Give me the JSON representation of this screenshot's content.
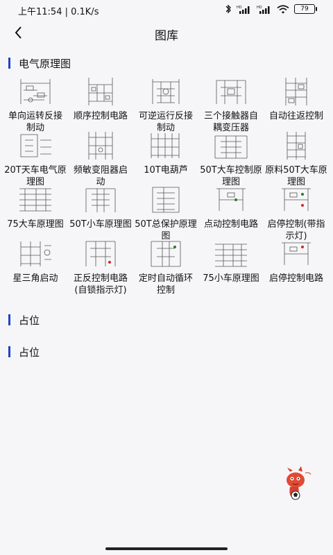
{
  "status": {
    "time_speed": "上午11:54 | 0.1K/s",
    "battery": "79",
    "icons": [
      "bluetooth-icon",
      "hd-signal-icon",
      "hd-signal-icon",
      "wifi-icon",
      "battery-icon"
    ]
  },
  "header": {
    "title": "图库",
    "back_icon": "chevron-left-icon"
  },
  "sections": [
    {
      "title": "电气原理图"
    },
    {
      "title": "占位"
    },
    {
      "title": "占位"
    }
  ],
  "items": [
    {
      "label": "单向运转反接制动"
    },
    {
      "label": "顺序控制电路"
    },
    {
      "label": "可逆运行反接制动"
    },
    {
      "label": "三个接触器自耦变压器"
    },
    {
      "label": "自动往返控制"
    },
    {
      "label": "20T天车电气原理图"
    },
    {
      "label": "频敏变阻器启动"
    },
    {
      "label": "10T电葫芦"
    },
    {
      "label": "50T大车控制原理图"
    },
    {
      "label": "原料50T大车原理图"
    },
    {
      "label": "75大车原理图"
    },
    {
      "label": "50T小车原理图"
    },
    {
      "label": "50T总保护原理图"
    },
    {
      "label": "点动控制电路"
    },
    {
      "label": "启停控制(带指示灯)"
    },
    {
      "label": "星三角启动"
    },
    {
      "label": "正反控制电路(自锁指示灯)"
    },
    {
      "label": "定时自动循环控制"
    },
    {
      "label": "75小车原理图"
    },
    {
      "label": "启停控制电路"
    }
  ]
}
